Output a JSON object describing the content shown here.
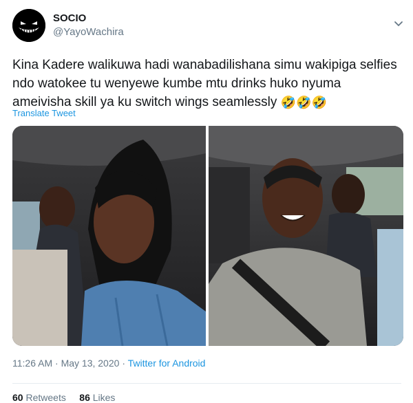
{
  "user": {
    "display_name": "SOCIO",
    "handle": "@YayoWachira",
    "avatar_icon": "grinning-face-avatar"
  },
  "tweet": {
    "text": "Kina Kadere walikuwa hadi wanabadilishana simu wakipiga selfies ndo watokee tu wenyewe kumbe mtu drinks huko nyuma ameivisha skill ya ku switch wings seamlessly",
    "emojis": "🤣🤣🤣",
    "translate_label": "Translate Tweet",
    "time": "11:26 AM",
    "sep1": "·",
    "date": "May 13, 2020",
    "sep2": "·",
    "source": "Twitter for Android"
  },
  "media": {
    "left_photo_icon": "car-selfie-woman-photo",
    "right_photo_icon": "car-selfie-man-photo"
  },
  "stats": {
    "retweets_count": "60",
    "retweets_label": "Retweets",
    "likes_count": "86",
    "likes_label": "Likes"
  },
  "colors": {
    "link": "#1b95e0",
    "secondary": "#657786",
    "text": "#14171a"
  }
}
